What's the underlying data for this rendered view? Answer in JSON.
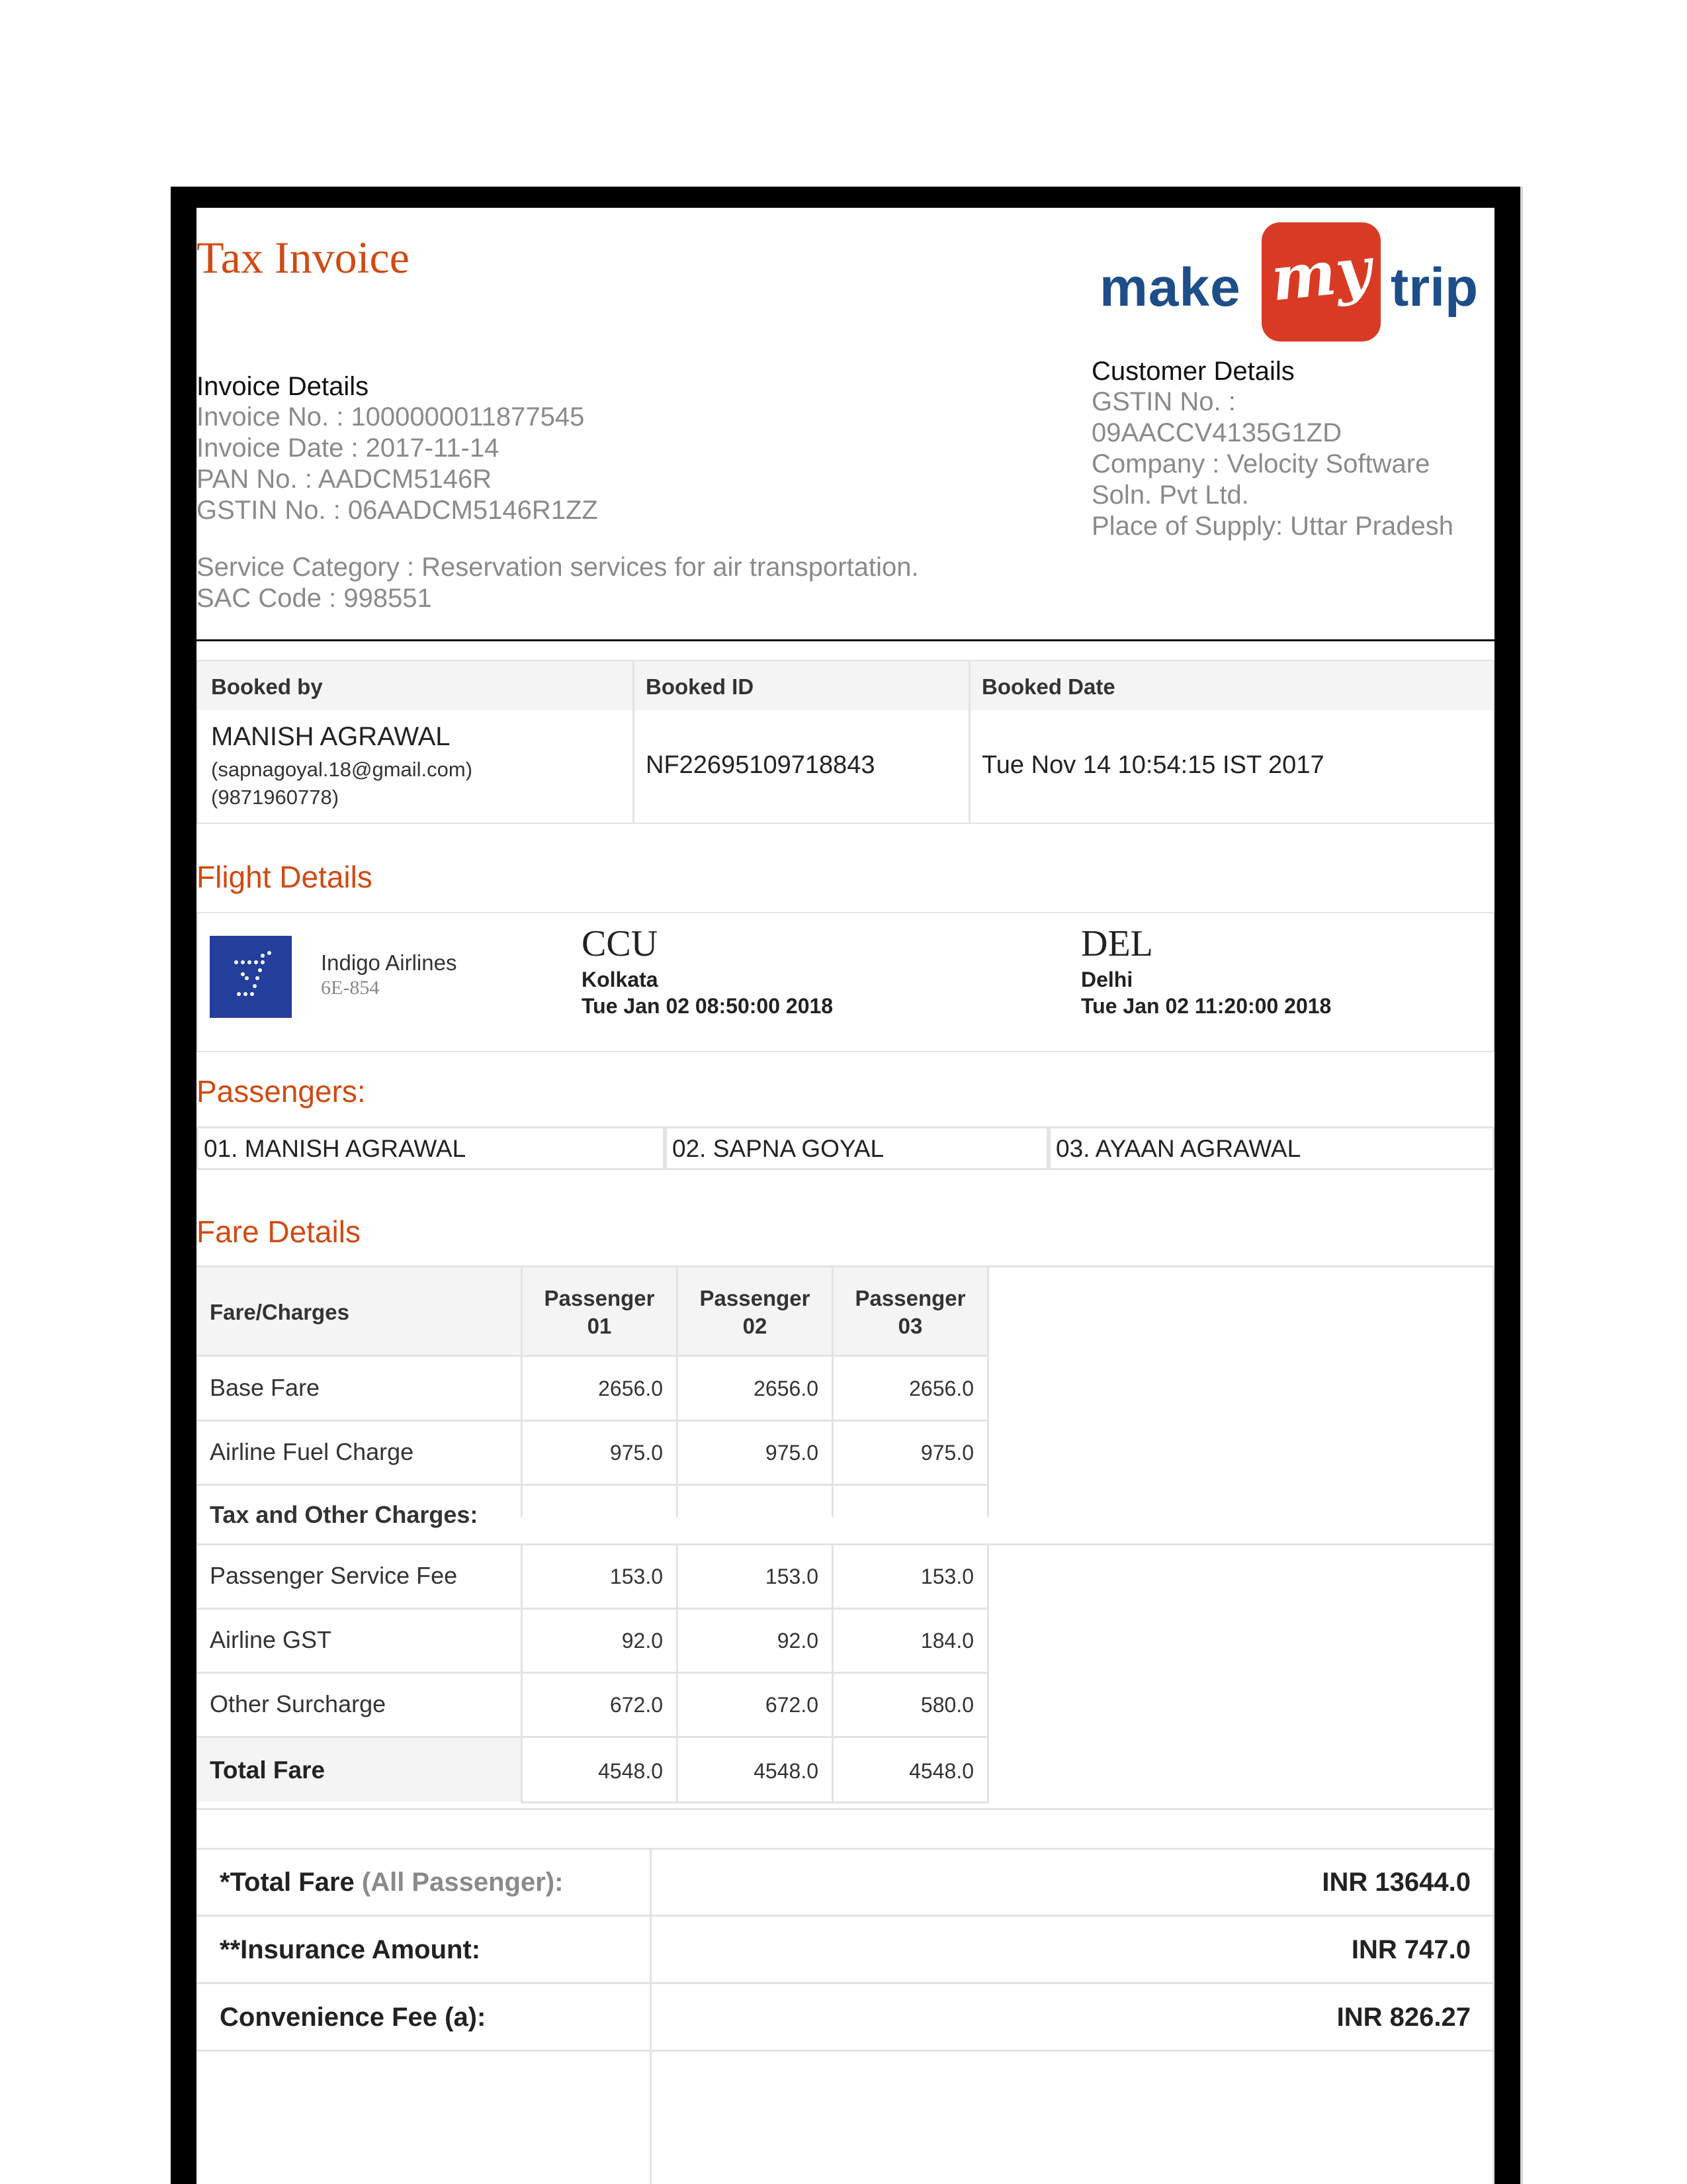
{
  "header": {
    "title": "Tax Invoice",
    "logo": {
      "part1": "make",
      "part2": "my",
      "part3": "trip",
      "brand_colors": {
        "blue": "#1d4e8a",
        "red": "#d93a23"
      }
    }
  },
  "invoice_details": {
    "heading": "Invoice Details",
    "invoice_no": "Invoice No. : 1000000011877545",
    "invoice_date": "Invoice Date : 2017-11-14",
    "pan_no": "PAN No. : AADCM5146R",
    "gstin_no": "GSTIN No. : 06AADCM5146R1ZZ",
    "service_category": "Service Category : Reservation services for air transportation.",
    "sac_code": "SAC Code : 998551"
  },
  "customer_details": {
    "heading": "Customer Details",
    "gstin_label": "GSTIN No. :",
    "gstin_value": "09AACCV4135G1ZD",
    "company_line1": "Company : Velocity Software",
    "company_line2": "Soln. Pvt Ltd.",
    "place_of_supply": "Place of Supply: Uttar Pradesh"
  },
  "booking": {
    "headers": [
      "Booked by",
      "Booked ID",
      "Booked Date"
    ],
    "name": "MANISH AGRAWAL",
    "email": "(sapnagoyal.18@gmail.com)",
    "phone": "(9871960778)",
    "booked_id": "NF22695109718843",
    "booked_date": "Tue Nov 14 10:54:15 IST 2017"
  },
  "flight": {
    "section_title": "Flight Details",
    "airline": "Indigo Airlines",
    "flight_no": "6E-854",
    "from_code": "CCU",
    "from_city": "Kolkata",
    "from_time": "Tue Jan 02 08:50:00 2018",
    "to_code": "DEL",
    "to_city": "Delhi",
    "to_time": "Tue Jan 02 11:20:00 2018"
  },
  "passengers": {
    "section_title": "Passengers:",
    "list": [
      "01. MANISH AGRAWAL",
      "02. SAPNA GOYAL",
      "03. AYAAN AGRAWAL"
    ]
  },
  "fare": {
    "section_title": "Fare Details",
    "col_label": "Fare/Charges",
    "col_p1": [
      "Passenger",
      "01"
    ],
    "col_p2": [
      "Passenger",
      "02"
    ],
    "col_p3": [
      "Passenger",
      "03"
    ],
    "rows": [
      {
        "label": "Base Fare",
        "values": [
          "2656.0",
          "2656.0",
          "2656.0"
        ]
      },
      {
        "label": "Airline Fuel Charge",
        "values": [
          "975.0",
          "975.0",
          "975.0"
        ]
      }
    ],
    "tax_heading": "Tax and Other Charges:",
    "tax_rows": [
      {
        "label": "Passenger Service Fee",
        "values": [
          "153.0",
          "153.0",
          "153.0"
        ]
      },
      {
        "label": "Airline GST",
        "values": [
          "92.0",
          "92.0",
          "184.0"
        ]
      },
      {
        "label": "Other Surcharge",
        "values": [
          "672.0",
          "672.0",
          "580.0"
        ]
      }
    ],
    "total": {
      "label": "Total Fare",
      "values": [
        "4548.0",
        "4548.0",
        "4548.0"
      ]
    }
  },
  "summary": {
    "total_label": "*Total Fare",
    "total_label_note": "(All Passenger):",
    "total_value": "INR 13644.0",
    "insurance_label": "**Insurance Amount:",
    "insurance_value": "INR 747.0",
    "convenience_label": "Convenience Fee (a):",
    "convenience_value": "INR 826.27"
  }
}
